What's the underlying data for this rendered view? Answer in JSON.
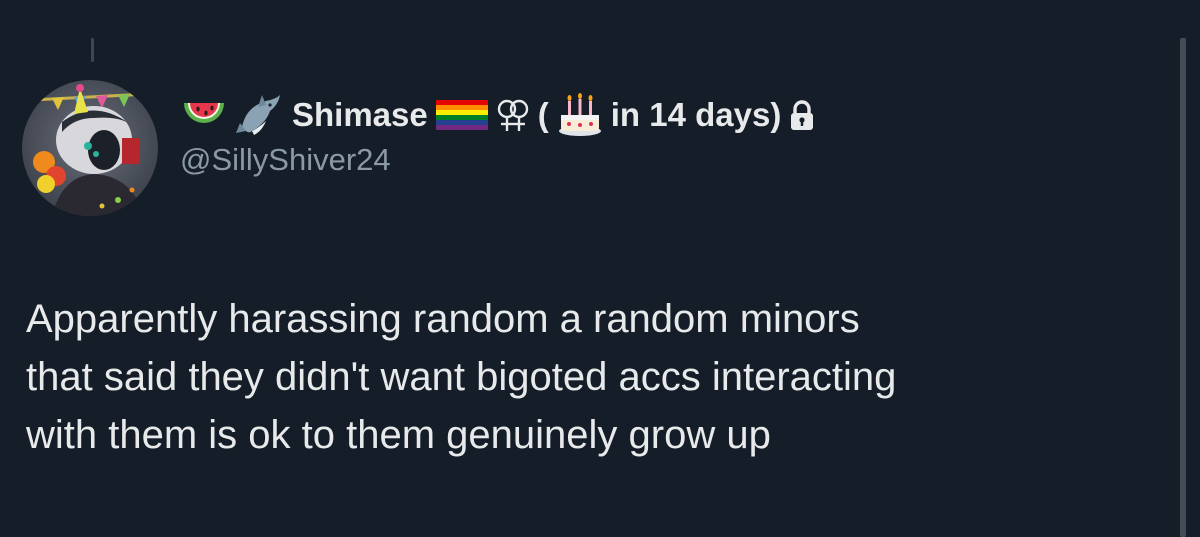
{
  "post": {
    "author": {
      "name_prefix_emojis": [
        "watermelon-icon",
        "shark-icon"
      ],
      "display_name": "Shimase",
      "name_suffix_icons": [
        "rainbow-flag-icon",
        "sapphic-symbol-icon"
      ],
      "birthday_open": "(",
      "birthday_icon": "birthday-cake-icon",
      "birthday_text": "in 14 days)",
      "protected_icon": "lock-icon",
      "handle": "@SillyShiver24"
    },
    "text": "Apparently harassing random a random minors\nthat said they didn't want bigoted accs interacting\nwith them is ok to them genuinely grow up"
  },
  "colors": {
    "background": "#151d28",
    "primary_text": "#e7e9ea",
    "secondary_text": "#8b98a5",
    "thread_line": "#3e4650"
  }
}
